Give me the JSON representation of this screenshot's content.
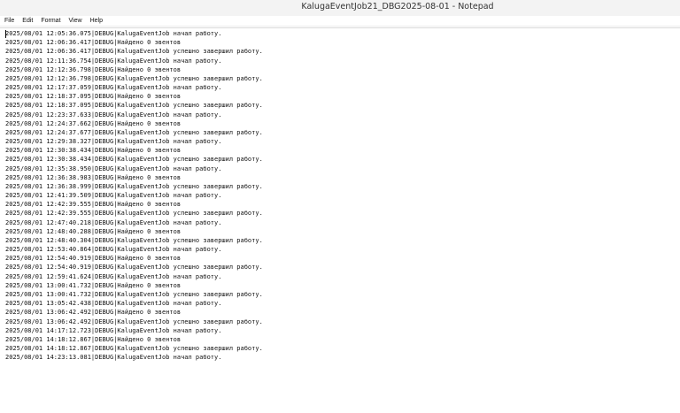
{
  "window": {
    "title": "KalugaEventJob21_DBG2025-08-01 - Notepad"
  },
  "menu": [
    "File",
    "Edit",
    "Format",
    "View",
    "Help"
  ],
  "log_lines": [
    "2025/08/01 12:05:36.075|DEBUG|KalugaEventJob начал работу.",
    "2025/08/01 12:06:36.417|DEBUG|Найдено 0 эвентов",
    "2025/08/01 12:06:36.417|DEBUG|KalugaEventJob успешно завершил работу.",
    "2025/08/01 12:11:36.754|DEBUG|KalugaEventJob начал работу.",
    "2025/08/01 12:12:36.798|DEBUG|Найдено 0 эвентов",
    "2025/08/01 12:12:36.798|DEBUG|KalugaEventJob успешно завершил работу.",
    "2025/08/01 12:17:37.059|DEBUG|KalugaEventJob начал работу.",
    "2025/08/01 12:18:37.095|DEBUG|Найдено 0 эвентов",
    "2025/08/01 12:18:37.095|DEBUG|KalugaEventJob успешно завершил работу.",
    "2025/08/01 12:23:37.633|DEBUG|KalugaEventJob начал работу.",
    "2025/08/01 12:24:37.662|DEBUG|Найдено 0 эвентов",
    "2025/08/01 12:24:37.677|DEBUG|KalugaEventJob успешно завершил работу.",
    "2025/08/01 12:29:38.327|DEBUG|KalugaEventJob начал работу.",
    "2025/08/01 12:30:38.434|DEBUG|Найдено 0 эвентов",
    "2025/08/01 12:30:38.434|DEBUG|KalugaEventJob успешно завершил работу.",
    "2025/08/01 12:35:38.950|DEBUG|KalugaEventJob начал работу.",
    "2025/08/01 12:36:38.983|DEBUG|Найдено 0 эвентов",
    "2025/08/01 12:36:38.999|DEBUG|KalugaEventJob успешно завершил работу.",
    "2025/08/01 12:41:39.509|DEBUG|KalugaEventJob начал работу.",
    "2025/08/01 12:42:39.555|DEBUG|Найдено 0 эвентов",
    "2025/08/01 12:42:39.555|DEBUG|KalugaEventJob успешно завершил работу.",
    "2025/08/01 12:47:40.218|DEBUG|KalugaEventJob начал работу.",
    "2025/08/01 12:48:40.288|DEBUG|Найдено 0 эвентов",
    "2025/08/01 12:48:40.304|DEBUG|KalugaEventJob успешно завершил работу.",
    "2025/08/01 12:53:40.864|DEBUG|KalugaEventJob начал работу.",
    "2025/08/01 12:54:40.919|DEBUG|Найдено 0 эвентов",
    "2025/08/01 12:54:40.919|DEBUG|KalugaEventJob успешно завершил работу.",
    "2025/08/01 12:59:41.624|DEBUG|KalugaEventJob начал работу.",
    "2025/08/01 13:00:41.732|DEBUG|Найдено 0 эвентов",
    "2025/08/01 13:00:41.732|DEBUG|KalugaEventJob успешно завершил работу.",
    "2025/08/01 13:05:42.438|DEBUG|KalugaEventJob начал работу.",
    "2025/08/01 13:06:42.492|DEBUG|Найдено 0 эвентов",
    "2025/08/01 13:06:42.492|DEBUG|KalugaEventJob успешно завершил работу.",
    "2025/08/01 14:17:12.723|DEBUG|KalugaEventJob начал работу.",
    "2025/08/01 14:18:12.867|DEBUG|Найдено 0 эвентов",
    "2025/08/01 14:18:12.867|DEBUG|KalugaEventJob успешно завершил работу.",
    "2025/08/01 14:23:13.081|DEBUG|KalugaEventJob начал работу."
  ]
}
